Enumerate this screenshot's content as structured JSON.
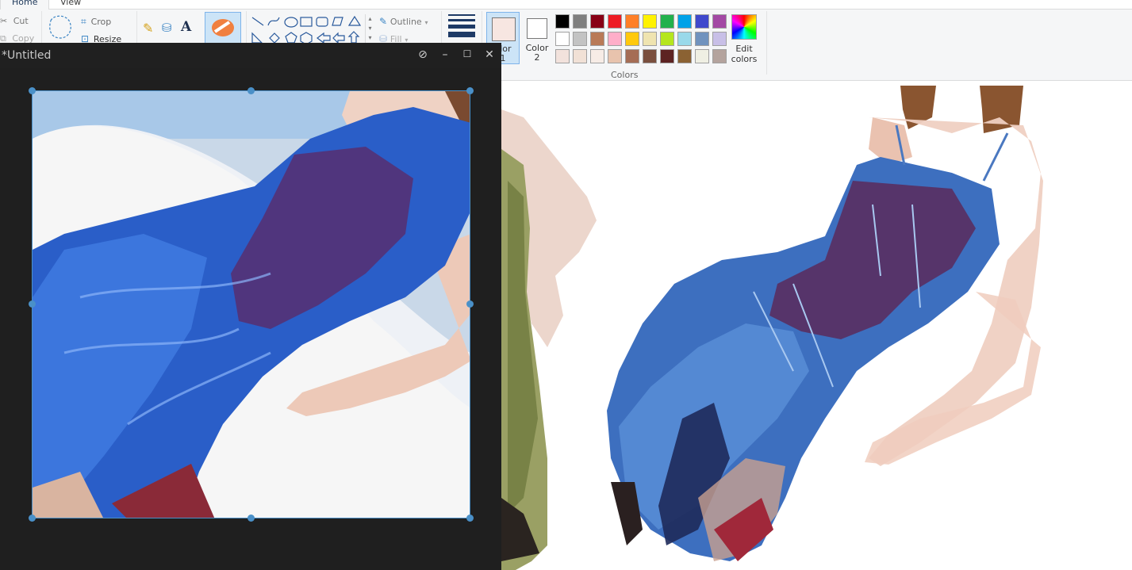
{
  "ribbon": {
    "tabs": [
      "Home",
      "View"
    ],
    "clipboard": {
      "cut": "Cut",
      "copy": "Copy"
    },
    "image": {
      "crop": "Crop",
      "resize": "Resize"
    },
    "shapes": {
      "outline": "Outline",
      "fill": "Fill"
    },
    "color1_label": "olor\n1",
    "color2_label": "Color\n2",
    "colors_group_label": "Colors",
    "edit_colors_label": "Edit\ncolors",
    "palette_row1": [
      "#000000",
      "#7f7f7f",
      "#880015",
      "#ed1c24",
      "#ff7f27",
      "#fff200",
      "#22b14c",
      "#00a2e8",
      "#3f48cc",
      "#a349a4"
    ],
    "palette_row2": [
      "#ffffff",
      "#c3c3c3",
      "#b97a57",
      "#ffaec9",
      "#ffc90e",
      "#efe4b0",
      "#b5e61d",
      "#99d9ea",
      "#7092be",
      "#c8bfe7"
    ],
    "palette_row3": [
      "#f2e2dc",
      "#f1e1d6",
      "#f7ece6",
      "#e8c3ad",
      "#a56d55",
      "#7a4f3e",
      "#5d2322",
      "#8b6233",
      "#efefe3",
      "#b4a39d"
    ],
    "color1_value": "#f7e6e1",
    "color2_value": "#ffffff"
  },
  "snip_window": {
    "title": "*Untitled",
    "icons": [
      "unpin-icon",
      "minimize-icon",
      "maximize-icon",
      "close-icon"
    ]
  }
}
